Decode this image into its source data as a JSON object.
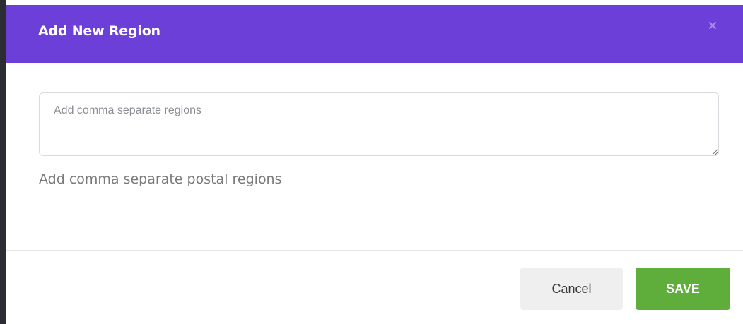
{
  "dialog": {
    "title": "Add New Region",
    "close_icon": "close-icon"
  },
  "form": {
    "regions_input": {
      "value": "",
      "placeholder": "Add comma separate regions"
    },
    "help_text": "Add comma separate postal regions"
  },
  "footer": {
    "cancel_label": "Cancel",
    "save_label": "SAVE"
  },
  "colors": {
    "header_bg": "#6c3fd9",
    "save_bg": "#5fae3b",
    "cancel_bg": "#efefef"
  }
}
